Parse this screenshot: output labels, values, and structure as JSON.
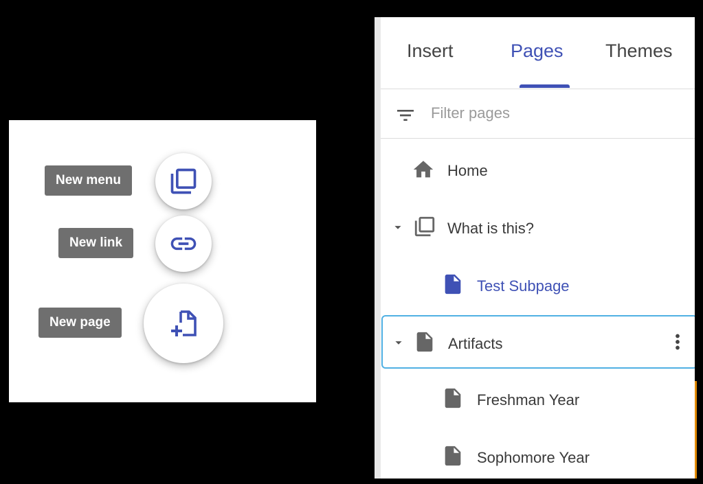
{
  "fab_menu": {
    "items": [
      {
        "label": "New menu",
        "icon": "new-menu-icon"
      },
      {
        "label": "New link",
        "icon": "link-icon"
      },
      {
        "label": "New page",
        "icon": "new-page-icon"
      }
    ]
  },
  "pages_panel": {
    "tabs": [
      {
        "label": "Insert"
      },
      {
        "label": "Pages"
      },
      {
        "label": "Themes"
      }
    ],
    "active_tab": "Pages",
    "filter": {
      "placeholder": "Filter pages",
      "icon": "filter-icon"
    },
    "items": [
      {
        "label": "Home",
        "icon": "home-icon"
      },
      {
        "label": "What is this?",
        "icon": "menu-pages-icon",
        "expanded": true
      },
      {
        "label": "Test Subpage",
        "icon": "page-icon",
        "current": true
      },
      {
        "label": "Artifacts",
        "icon": "page-icon",
        "expanded": true,
        "selected": true
      },
      {
        "label": "Freshman Year",
        "icon": "page-icon"
      },
      {
        "label": "Sophomore Year",
        "icon": "page-icon"
      }
    ]
  },
  "colors": {
    "accent": "#3f51b5",
    "label_bg": "#6f6f6f",
    "selection_border": "#4fb0e3",
    "icon_gray": "#666666"
  }
}
